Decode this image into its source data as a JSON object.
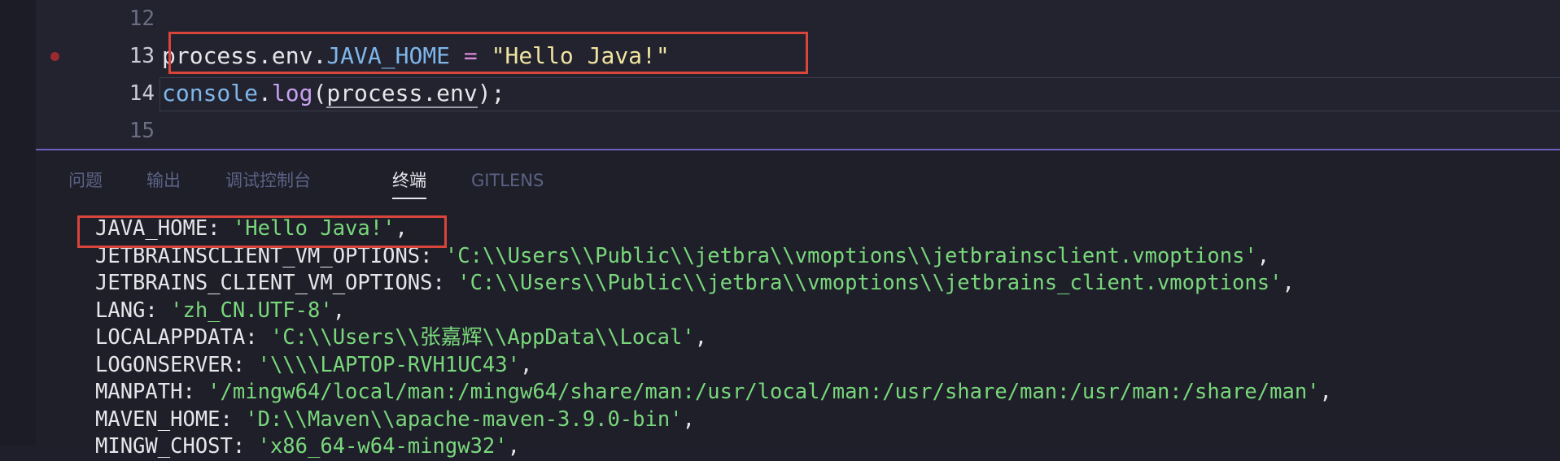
{
  "editor": {
    "lines": [
      {
        "num": "12"
      },
      {
        "num": "13",
        "obj": "process",
        "dot1": ".",
        "env": "env",
        "dot2": ".",
        "prop": "JAVA_HOME",
        "sp1": " ",
        "eq": "=",
        "sp2": " ",
        "str": "\"Hello Java!\""
      },
      {
        "num": "14",
        "obj": "console",
        "dot": ".",
        "fn": "log",
        "open": "(",
        "arg": "process.env",
        "close": ");"
      },
      {
        "num": "15"
      }
    ]
  },
  "panel": {
    "tabs": [
      {
        "label": "问题"
      },
      {
        "label": "输出"
      },
      {
        "label": "调试控制台"
      },
      {
        "label": "终端"
      },
      {
        "label": "GITLENS"
      }
    ],
    "active_tab": "终端"
  },
  "terminal": {
    "rows": [
      {
        "key": "JAVA_HOME: ",
        "value": "'Hello Java!'",
        "suffix": ","
      },
      {
        "key": "JETBRAINSCLIENT_VM_OPTIONS: ",
        "value": "'C:\\\\Users\\\\Public\\\\jetbra\\\\vmoptions\\\\jetbrainsclient.vmoptions'",
        "suffix": ","
      },
      {
        "key": "JETBRAINS_CLIENT_VM_OPTIONS: ",
        "value": "'C:\\\\Users\\\\Public\\\\jetbra\\\\vmoptions\\\\jetbrains_client.vmoptions'",
        "suffix": ","
      },
      {
        "key": "LANG: ",
        "value": "'zh_CN.UTF-8'",
        "suffix": ","
      },
      {
        "key": "LOCALAPPDATA: ",
        "value": "'C:\\\\Users\\\\张嘉辉\\\\AppData\\\\Local'",
        "suffix": ","
      },
      {
        "key": "LOGONSERVER: ",
        "value": "'\\\\\\\\LAPTOP-RVH1UC43'",
        "suffix": ","
      },
      {
        "key": "MANPATH: ",
        "value": "'/mingw64/local/man:/mingw64/share/man:/usr/local/man:/usr/share/man:/usr/man:/share/man'",
        "suffix": ","
      },
      {
        "key": "MAVEN_HOME: ",
        "value": "'D:\\\\Maven\\\\apache-maven-3.9.0-bin'",
        "suffix": ","
      },
      {
        "key": "MINGW_CHOST: ",
        "value": "'x86_64-w64-mingw32'",
        "suffix": ","
      }
    ]
  },
  "colors": {
    "highlight_box": "#d9443b",
    "string_green": "#79d87b",
    "property_blue": "#7fb6ea",
    "operator_pink": "#d98ad6",
    "panel_divider": "#6c5fbd"
  }
}
